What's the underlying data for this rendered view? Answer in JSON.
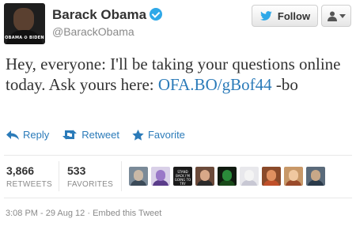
{
  "profile": {
    "name": "Barack Obama",
    "handle": "@BarackObama",
    "avatar_banner": "OBAMA ✪ BIDEN",
    "verified": true
  },
  "header": {
    "follow_label": "Follow"
  },
  "tweet": {
    "text_before_link": "Hey, everyone: I'll be taking your questions online today. Ask yours here: ",
    "link_text": "OFA.BO/gBof44",
    "text_after_link": " -bo"
  },
  "actions": {
    "reply": "Reply",
    "retweet": "Retweet",
    "favorite": "Favorite"
  },
  "stats": {
    "retweets_count": "3,866",
    "retweets_label": "RETWEETS",
    "favorites_count": "533",
    "favorites_label": "FAVORITES"
  },
  "retweeter_avatars": [
    {
      "bg": "#7a8a98",
      "head": "#c9b8a6",
      "body": "#3b4a58"
    },
    {
      "bg": "#d9d0e8",
      "head": "#9a78c8",
      "body": "#5a3c8a"
    },
    {
      "bg": "#1a1a1a",
      "head": "#1a1a1a",
      "body": "#1a1a1a",
      "text": "STAND BACK I'M GOING TO TRY SCIENCE"
    },
    {
      "bg": "#6b4a3a",
      "head": "#d8a888",
      "body": "#2a2a2a"
    },
    {
      "bg": "#101a10",
      "head": "#2a8a3a",
      "body": "#1a4a1a"
    },
    {
      "bg": "#e8e8ec",
      "head": "#f4f4f4",
      "body": "#c8c8d4"
    },
    {
      "bg": "#8a4a2a",
      "head": "#e09060",
      "body": "#c0502a"
    },
    {
      "bg": "#c89868",
      "head": "#f0c8a0",
      "body": "#9a4a2a"
    },
    {
      "bg": "#5a6a7a",
      "head": "#c8a888",
      "body": "#2a3a4a"
    }
  ],
  "meta": {
    "timestamp": "3:08 PM - 29 Aug 12",
    "separator": " · ",
    "embed_label": "Embed this Tweet"
  },
  "colors": {
    "link": "#2b7bb9",
    "verified": "#2fa8e8"
  }
}
